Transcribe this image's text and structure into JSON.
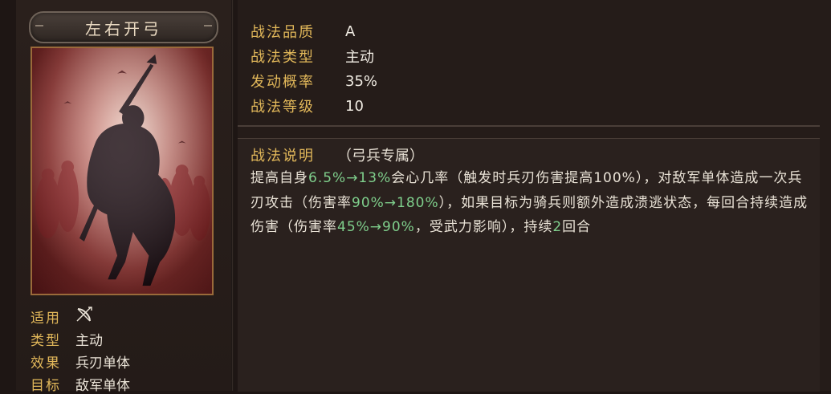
{
  "skill": {
    "name": "左右开弓",
    "quality_label": "战法品质",
    "quality_value": "A",
    "type_label": "战法类型",
    "type_value": "主动",
    "rate_label": "发动概率",
    "rate_value": "35%",
    "level_label": "战法等级",
    "level_value": "10"
  },
  "info": {
    "apply_label": "适用",
    "apply_icon": "bow-icon",
    "type_label": "类型",
    "type_value": "主动",
    "effect_label": "效果",
    "effect_value": "兵刃单体",
    "target_label": "目标",
    "target_value": "敌军单体"
  },
  "description": {
    "title": "战法说明",
    "subtitle": "（弓兵专属）",
    "segments": [
      {
        "t": "提高自身"
      },
      {
        "t": "6.5%→13%",
        "hl": true
      },
      {
        "t": "会心几率（触发时兵刃伤害提高100%），对敌军单体造成一次兵刃攻击（伤害率"
      },
      {
        "t": "90%→180%",
        "hl": true
      },
      {
        "t": "），如果目标为骑兵则额外造成溃逃状态，每回合持续造成伤害（伤害率"
      },
      {
        "t": "45%→90%",
        "hl": true
      },
      {
        "t": "，受武力影响），持续"
      },
      {
        "t": "2",
        "hl": true
      },
      {
        "t": "回合"
      }
    ]
  },
  "colors": {
    "label": "#e2b85a",
    "highlight": "#7fcf8c",
    "text": "#e9e2d6"
  }
}
